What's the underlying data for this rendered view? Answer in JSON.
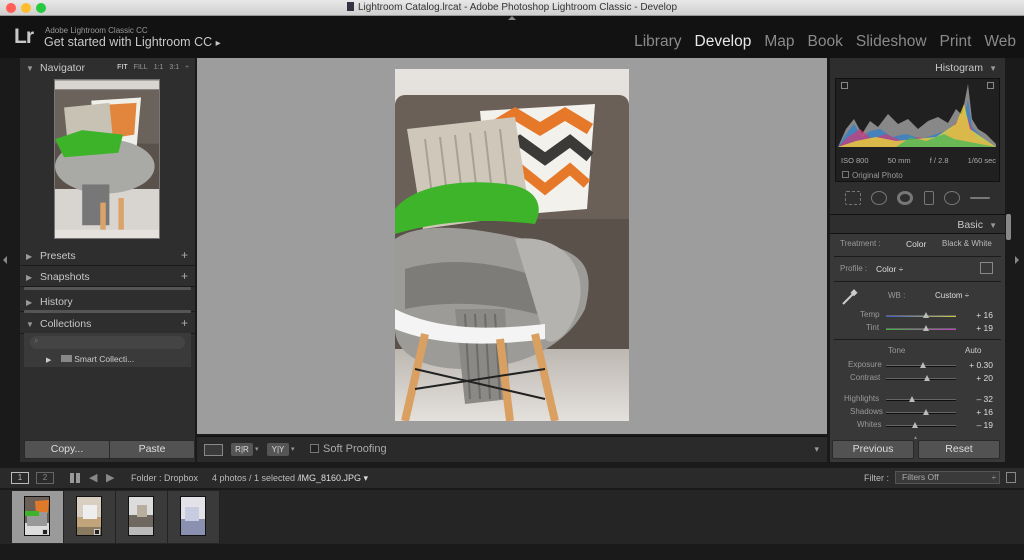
{
  "window": {
    "title": "Lightroom Catalog.lrcat - Adobe Photoshop Lightroom Classic - Develop",
    "traffic_colors": [
      "#ff5f57",
      "#ffbd2e",
      "#28c940"
    ]
  },
  "identity": {
    "logo": "Lr",
    "product": "Adobe Lightroom Classic CC",
    "subtitle": "Get started with Lightroom CC",
    "arrow": "▸"
  },
  "modules": [
    "Library",
    "Develop",
    "Map",
    "Book",
    "Slideshow",
    "Print",
    "Web"
  ],
  "left_panel": {
    "navigator": {
      "label": "Navigator",
      "options": [
        "FIT",
        "FILL",
        "1:1",
        "3:1"
      ],
      "selected": "FIT"
    },
    "presets": "Presets",
    "snapshots": "Snapshots",
    "history": "History",
    "collections": "Collections",
    "smart_collection": "Smart Collecti...",
    "copy_label": "Copy...",
    "paste_label": "Paste"
  },
  "toolbar": {
    "compare1": "R|R",
    "compare2": "Y|Y",
    "soft_proofing": "Soft Proofing"
  },
  "right_panel": {
    "histogram": {
      "label": "Histogram",
      "iso": "ISO 800",
      "focal": "50 mm",
      "aperture": "f / 2.8",
      "shutter": "1/60 sec",
      "original_photo": "Original Photo"
    },
    "basic": {
      "label": "Basic",
      "treatment_label": "Treatment :",
      "treatment_color": "Color",
      "treatment_bw": "Black & White",
      "profile_label": "Profile :",
      "profile_value": "Color ÷",
      "wb_label": "WB :",
      "wb_value": "Custom ÷",
      "tone_label": "Tone",
      "auto_label": "Auto",
      "sliders": [
        {
          "label": "Temp",
          "value": "+ 16",
          "pos": 0.55
        },
        {
          "label": "Tint",
          "value": "+ 19",
          "pos": 0.55
        },
        {
          "label": "Exposure",
          "value": "+ 0.30",
          "pos": 0.52
        },
        {
          "label": "Contrast",
          "value": "+ 20",
          "pos": 0.58
        },
        {
          "label": "Highlights",
          "value": "– 32",
          "pos": 0.35
        },
        {
          "label": "Shadows",
          "value": "+ 16",
          "pos": 0.55
        },
        {
          "label": "Whites",
          "value": "– 19",
          "pos": 0.4
        }
      ]
    },
    "previous_label": "Previous",
    "reset_label": "Reset"
  },
  "filmstrip": {
    "page1": "1",
    "page2": "2",
    "folder": "Folder : Dropbox",
    "count": "4 photos / 1 selected /",
    "filename": "IMG_8160.JPG ▾",
    "filter_label": "Filter :",
    "filter_value": "Filters Off"
  }
}
